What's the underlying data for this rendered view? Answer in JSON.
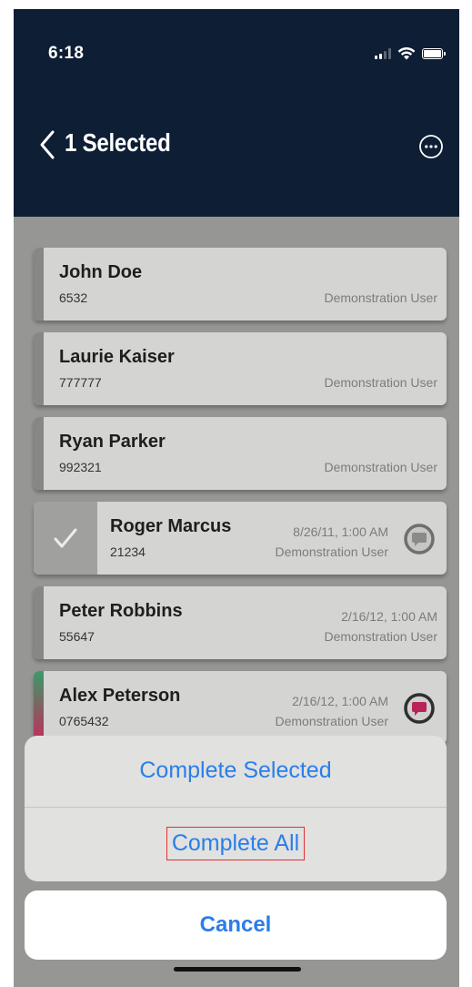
{
  "status_bar": {
    "time": "6:18",
    "signal_icon": "cellular-signal-icon",
    "wifi_icon": "wifi-icon",
    "battery_icon": "battery-icon"
  },
  "header": {
    "back_icon": "chevron-left-icon",
    "title": "1 Selected",
    "more_icon": "ellipsis-circle-icon"
  },
  "list": {
    "items": [
      {
        "name": "John Doe",
        "id": "6532",
        "date": "",
        "user": "Demonstration User",
        "selected": false
      },
      {
        "name": "Laurie Kaiser",
        "id": "777777",
        "date": "",
        "user": "Demonstration User",
        "selected": false
      },
      {
        "name": "Ryan Parker",
        "id": "992321",
        "date": "",
        "user": "Demonstration User",
        "selected": false
      },
      {
        "name": "Roger Marcus",
        "id": "21234",
        "date": "8/26/11, 1:00 AM",
        "user": "Demonstration User",
        "selected": true
      },
      {
        "name": "Peter Robbins",
        "id": "55647",
        "date": "2/16/12, 1:00 AM",
        "user": "Demonstration User",
        "selected": false
      },
      {
        "name": "Alex Peterson",
        "id": "0765432",
        "date": "2/16/12, 1:00 AM",
        "user": "Demonstration User",
        "selected": false
      }
    ]
  },
  "action_sheet": {
    "complete_selected_label": "Complete Selected",
    "complete_all_label": "Complete All",
    "cancel_label": "Cancel"
  },
  "colors": {
    "header_background": "#0e1e35",
    "action_text": "#2a7ee8",
    "alert_stripe_top": "#3a9a6a",
    "alert_stripe_bottom": "#c8285a",
    "highlight_border": "#e03030"
  }
}
